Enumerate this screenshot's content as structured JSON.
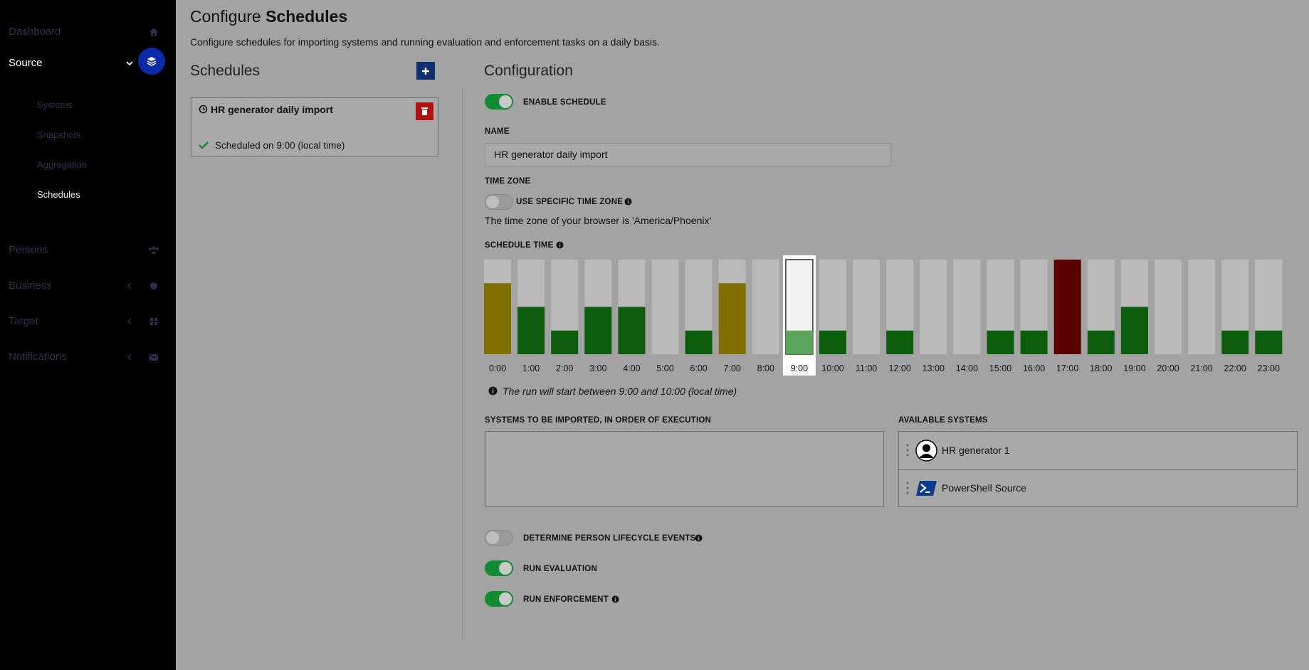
{
  "sidebar": {
    "items": [
      {
        "label": "Dashboard",
        "icon": "home-icon"
      },
      {
        "label": "Source",
        "icon": "layers-icon"
      },
      {
        "label": "Persons",
        "icon": "users-icon"
      },
      {
        "label": "Business",
        "icon": "globe-icon"
      },
      {
        "label": "Target",
        "icon": "grid-icon"
      },
      {
        "label": "Notifications",
        "icon": "envelope-icon"
      }
    ],
    "source_sub": [
      "Systems",
      "Snapshots",
      "Aggregation",
      "Schedules"
    ]
  },
  "page": {
    "title_prefix": "Configure",
    "title_strong": "Schedules",
    "description": "Configure schedules for importing systems and running evaluation and enforcement tasks on a daily basis."
  },
  "schedules": {
    "heading": "Schedules",
    "card": {
      "title": "HR generator daily import",
      "status": "Scheduled on 9:00 (local time)"
    }
  },
  "config": {
    "heading": "Configuration",
    "enable_label": "ENABLE SCHEDULE",
    "name_label": "NAME",
    "name_value": "HR generator daily import",
    "tz_label": "TIME ZONE",
    "tz_toggle_label": "USE SPECIFIC TIME ZONE",
    "tz_note": "The time zone of your browser is 'America/Phoenix'",
    "schedule_time_label": "SCHEDULE TIME",
    "run_note": "The run will start between 9:00 and 10:00 (local time)",
    "systems_label": "SYSTEMS TO BE IMPORTED, IN ORDER OF EXECUTION",
    "available_label": "AVAILABLE SYSTEMS",
    "available": [
      "HR generator 1",
      "PowerShell Source"
    ],
    "lifecycle_label": "DETERMINE PERSON LIFECYCLE EVENTS",
    "evaluation_label": "RUN EVALUATION",
    "enforcement_label": "RUN ENFORCEMENT",
    "toggles": {
      "enable": true,
      "tz": false,
      "lifecycle": false,
      "evaluation": true,
      "enforcement": true
    }
  },
  "chart_data": {
    "type": "bar",
    "categories": [
      "0:00",
      "1:00",
      "2:00",
      "3:00",
      "4:00",
      "5:00",
      "6:00",
      "7:00",
      "8:00",
      "9:00",
      "10:00",
      "11:00",
      "12:00",
      "13:00",
      "14:00",
      "15:00",
      "16:00",
      "17:00",
      "18:00",
      "19:00",
      "20:00",
      "21:00",
      "22:00",
      "23:00"
    ],
    "values": [
      3,
      2,
      1,
      2,
      2,
      0,
      1,
      3,
      0,
      1,
      1,
      0,
      1,
      0,
      0,
      1,
      1,
      4,
      1,
      2,
      0,
      0,
      1,
      1
    ],
    "ylim": [
      0,
      4
    ],
    "selected": "9:00",
    "colors": {
      "low": "#0b5c0b",
      "mid": "#7f7000",
      "high": "#5c0000",
      "selected": "#5aa55a",
      "track": "#bababa",
      "selected_track": "#f2f2f2"
    }
  }
}
